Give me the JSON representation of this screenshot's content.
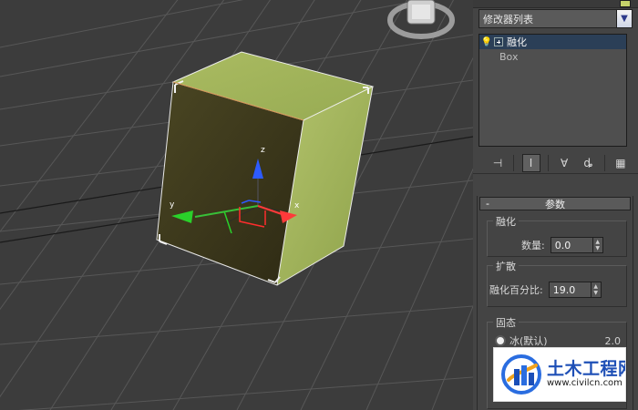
{
  "viewport": {
    "axis_labels": {
      "x": "x",
      "y": "y",
      "z": "z"
    },
    "colors": {
      "background": "#3c3c3c",
      "grid": "#5a5a5a",
      "object_face_front": "#3e3a1f",
      "object_face_side": "#a3b35d",
      "object_face_top": "#a1b35a",
      "selection_edge": "#f0f0f0",
      "axis_x": "#ff3a3a",
      "axis_y": "#2ad12a",
      "axis_z": "#2d5bff"
    }
  },
  "modifier_panel": {
    "dropdown_value": "修改器列表",
    "stack": [
      {
        "label": "融化",
        "selected": true,
        "icon": "lightbulb-icon"
      },
      {
        "label": "Box",
        "selected": false,
        "icon": ""
      }
    ],
    "toolbar": [
      "pin-stack-icon",
      "show-end-result-icon",
      "make-unique-icon",
      "remove-modifier-icon",
      "configure-modifier-sets-icon"
    ]
  },
  "parameters": {
    "rollout_title": "参数",
    "collapse_symbol": "-",
    "melt": {
      "group_title": "融化",
      "amount_label": "数量:",
      "amount_value": "0.0"
    },
    "spread": {
      "group_title": "扩散",
      "percent_label": "融化百分比:",
      "percent_value": "19.0"
    },
    "solidity": {
      "group_title": "固态",
      "option_label": "冰(默认)",
      "option_value": "2.0"
    }
  },
  "watermark": {
    "brand": "土木工程网",
    "url": "www.civilcn.com"
  },
  "arrows": {
    "dropdown": "▼",
    "spinner_up": "▲",
    "spinner_down": "▼"
  }
}
